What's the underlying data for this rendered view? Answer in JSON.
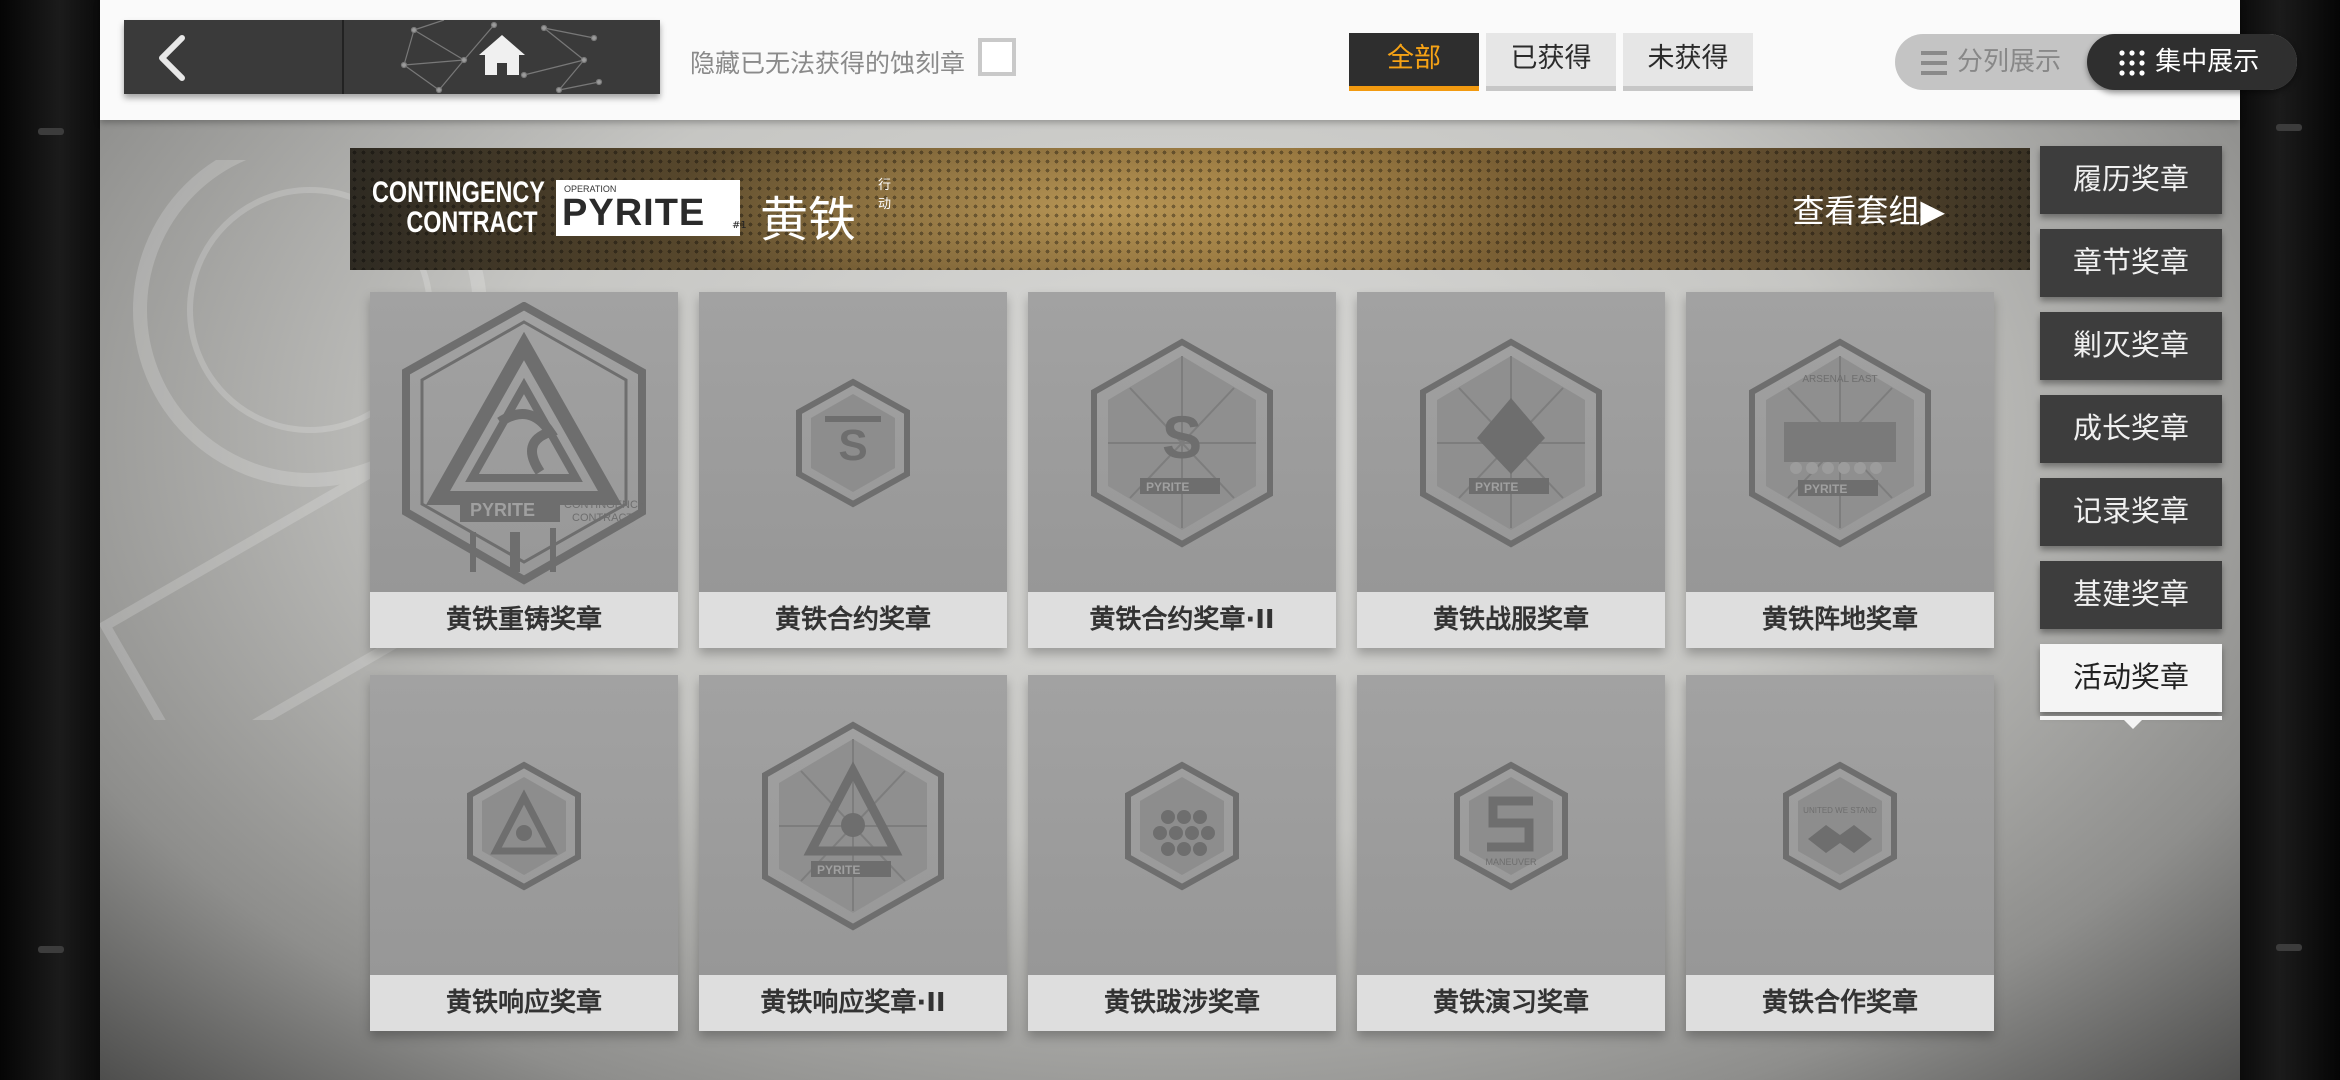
{
  "topbar": {
    "hide_unobtainable_label": "隐藏已无法获得的蚀刻章",
    "hide_unobtainable_checked": false,
    "filters": [
      {
        "label": "全部",
        "active": true
      },
      {
        "label": "已获得",
        "active": false
      },
      {
        "label": "未获得",
        "active": false
      }
    ],
    "view_modes": {
      "list_label": "分列展示",
      "grid_label": "集中展示",
      "active": "grid"
    }
  },
  "banner": {
    "logo_line1": "CONTINGENCY",
    "logo_line2": "CONTRACT",
    "operation_small": "OPERATION",
    "operation_name": "PYRITE",
    "operation_num": "#1",
    "chinese_name": "黄铁",
    "chinese_tag": "行动",
    "view_set_label": "查看套组▶"
  },
  "medals": [
    {
      "name": "黄铁重铸奖章",
      "icon": "pyrite-recast-medal-icon"
    },
    {
      "name": "黄铁合约奖章",
      "icon": "pyrite-contract-medal-icon"
    },
    {
      "name": "黄铁合约奖章·II",
      "icon": "pyrite-contract-ii-medal-icon"
    },
    {
      "name": "黄铁战服奖章",
      "icon": "pyrite-uniform-medal-icon"
    },
    {
      "name": "黄铁阵地奖章",
      "icon": "pyrite-position-medal-icon"
    },
    {
      "name": "黄铁响应奖章",
      "icon": "pyrite-response-medal-icon"
    },
    {
      "name": "黄铁响应奖章·II",
      "icon": "pyrite-response-ii-medal-icon"
    },
    {
      "name": "黄铁跋涉奖章",
      "icon": "pyrite-trek-medal-icon"
    },
    {
      "name": "黄铁演习奖章",
      "icon": "pyrite-maneuver-medal-icon"
    },
    {
      "name": "黄铁合作奖章",
      "icon": "pyrite-cooperation-medal-icon"
    }
  ],
  "medal_inscriptions": {
    "pyrite": "PYRITE",
    "contingency": "CONTINGENCY",
    "contract": "CONTRACT",
    "maneuver": "MANEUVER",
    "united": "UNITED WE STAND",
    "arsenal": "ARSENAL EAST"
  },
  "categories": [
    {
      "label": "履历奖章",
      "active": false
    },
    {
      "label": "章节奖章",
      "active": false
    },
    {
      "label": "剿灭奖章",
      "active": false
    },
    {
      "label": "成长奖章",
      "active": false
    },
    {
      "label": "记录奖章",
      "active": false
    },
    {
      "label": "基建奖章",
      "active": false
    },
    {
      "label": "活动奖章",
      "active": true
    }
  ],
  "colors": {
    "accent": "#f29a10",
    "dark_panel": "#3a3a3a",
    "card_bg": "#9b9b9b",
    "medal_gray": "#6e6e6e"
  }
}
